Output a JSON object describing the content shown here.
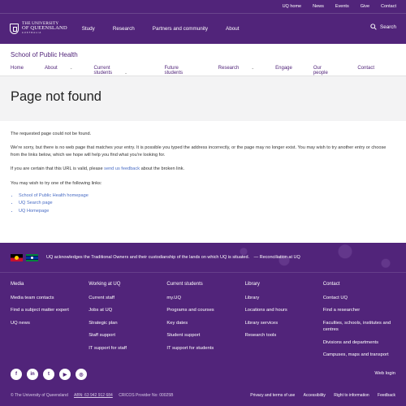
{
  "utility": [
    "UQ home",
    "News",
    "Events",
    "Give",
    "Contact"
  ],
  "logo": {
    "line1": "THE UNIVERSITY",
    "line2": "OF QUEENSLAND",
    "line3": "AUSTRALIA"
  },
  "main_nav": [
    "Study",
    "Research",
    "Partners and community",
    "About"
  ],
  "search_label": "Search",
  "site_title": "School of Public Health",
  "site_nav": [
    {
      "label": "Home",
      "chevron": false
    },
    {
      "label": "About",
      "chevron": true
    },
    {
      "label": "Current students",
      "chevron": true
    },
    {
      "label": "Future students",
      "chevron": false
    },
    {
      "label": "Research",
      "chevron": true
    },
    {
      "label": "Engage",
      "chevron": false
    },
    {
      "label": "Our people",
      "chevron": false
    },
    {
      "label": "Contact",
      "chevron": false
    }
  ],
  "page_title": "Page not found",
  "content": {
    "p1": "The requested page could not be found.",
    "p2": "We're sorry, but there is no web page that matches your entry. It is possible you typed the address incorrectly, or the page may no longer exist. You may wish to try another entry or choose from the links below, which we hope will help you find what you're looking for.",
    "p3_before": "If you are certain that this URL is valid, please ",
    "p3_link": "send us feedback",
    "p3_after": " about the broken link.",
    "p4": "You may wish to try one of the following links:",
    "links": [
      "School of Public Health homepage",
      "UQ Search page",
      "UQ Homepage"
    ]
  },
  "ack": {
    "text": "UQ acknowledges the Traditional Owners and their custodianship of the lands on which UQ is situated.",
    "link": "— Reconciliation at UQ"
  },
  "footer": {
    "columns": [
      {
        "heading": "Media",
        "items": [
          "Media team contacts",
          "Find a subject matter expert",
          "UQ news"
        ]
      },
      {
        "heading": "Working at UQ",
        "items": [
          "Current staff",
          "Jobs at UQ",
          "Strategic plan",
          "Staff support",
          "IT support for staff"
        ]
      },
      {
        "heading": "Current students",
        "items": [
          "my.UQ",
          "Programs and courses",
          "Key dates",
          "Student support",
          "IT support for students"
        ]
      },
      {
        "heading": "Library",
        "items": [
          "Library",
          "Locations and hours",
          "Library services",
          "Research tools"
        ]
      },
      {
        "heading": "Contact",
        "items": [
          "Contact UQ",
          "Find a researcher",
          "Faculties, schools, institutes and centres",
          "Divisions and departments",
          "Campuses, maps and transport"
        ]
      }
    ],
    "social": [
      {
        "icon": "facebook-icon",
        "glyph": "f"
      },
      {
        "icon": "linkedin-icon",
        "glyph": "in"
      },
      {
        "icon": "twitter-icon",
        "glyph": "t"
      },
      {
        "icon": "youtube-icon",
        "glyph": "▶"
      },
      {
        "icon": "instagram-icon",
        "glyph": "◎"
      }
    ],
    "web_login": "Web login",
    "copyright": "© The University of Queensland",
    "abn": "ABN: 63 942 912 684",
    "cricos": "CRICOS Provider No: 00025B",
    "bottom_links": [
      "Privacy and terms of use",
      "Accessibility",
      "Right to information",
      "Feedback"
    ]
  },
  "colors": {
    "brand": "#51247a",
    "link": "#4a6dc5",
    "band": "#f3f3f4"
  }
}
